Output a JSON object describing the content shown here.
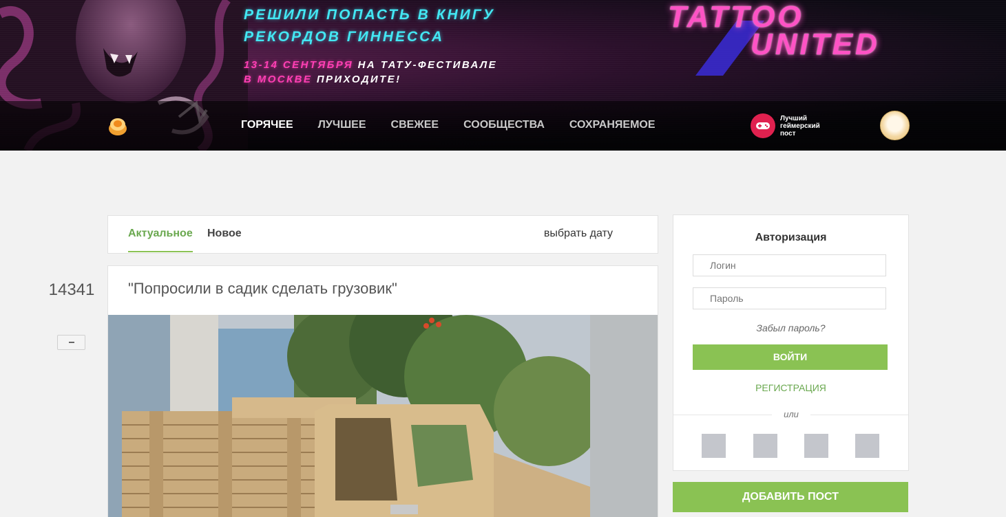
{
  "banner": {
    "promo_line1": "РЕШИЛИ ПОПАСТЬ В КНИГУ",
    "promo_line2": "РЕКОРДОВ ГИННЕССА",
    "promo_line3_pink": "13-14 СЕНТЯБРЯ",
    "promo_line3_white": " НА ТАТУ-ФЕСТИВАЛЕ",
    "promo_line4_pink": "В МОСКВЕ",
    "promo_line4_white": " ПРИХОДИТЕ!",
    "brand_line1": "TATTOO",
    "brand_line2": "UNITED"
  },
  "nav": {
    "items": [
      {
        "label": "ГОРЯЧЕЕ",
        "active": true
      },
      {
        "label": "ЛУЧШЕЕ",
        "active": false
      },
      {
        "label": "СВЕЖЕЕ",
        "active": false
      },
      {
        "label": "СООБЩЕСТВА",
        "active": false
      },
      {
        "label": "СОХРАНЯЕМОЕ",
        "active": false
      }
    ],
    "gamer_badge": "Лучший геймерский пост"
  },
  "tabs": {
    "actual": "Актуальное",
    "new": "Новое",
    "pick_date": "выбрать дату"
  },
  "post": {
    "rating": "14341",
    "title": "\"Попросили в садик сделать грузовик\""
  },
  "auth": {
    "title": "Авторизация",
    "login_placeholder": "Логин",
    "password_placeholder": "Пароль",
    "forgot": "Забыл пароль?",
    "login_button": "ВОЙТИ",
    "register": "РЕГИСТРАЦИЯ",
    "or": "или"
  },
  "add_post": "ДОБАВИТЬ ПОСТ",
  "colors": {
    "accent_green": "#8ac253",
    "link_green": "#6aa84f",
    "neon_cyan": "#43e7f3",
    "neon_pink": "#ff3fb4",
    "gamer_red": "#e0214f"
  }
}
